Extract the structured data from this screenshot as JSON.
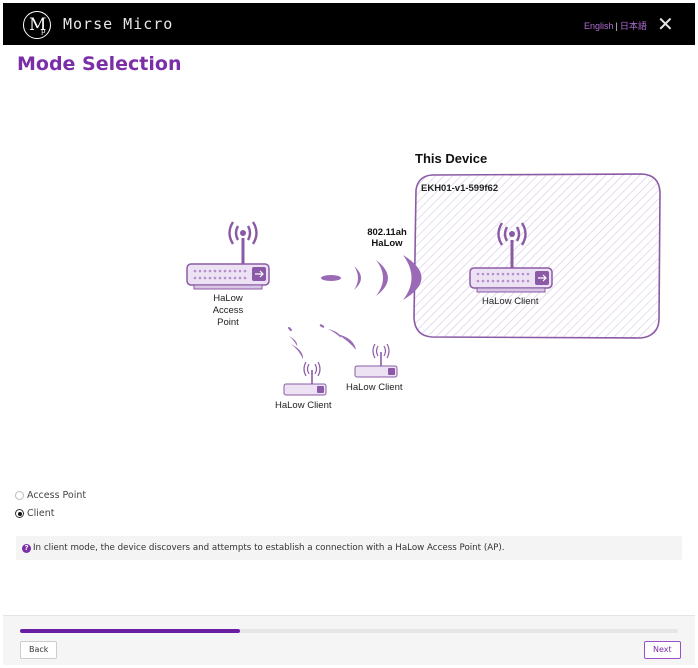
{
  "header": {
    "brand": "Morse Micro",
    "logo_letter": "M",
    "logo_sub": "p",
    "lang_english": "English",
    "lang_separator": "|",
    "lang_japanese": "日本語",
    "close_glyph": "✕"
  },
  "page": {
    "title": "Mode Selection"
  },
  "diagram": {
    "this_device_heading": "This Device",
    "device_id": "EKH01-v1-599f62",
    "link_label_line1": "802.11ah",
    "link_label_line2": "HaLow",
    "access_point_line1": "HaLow",
    "access_point_line2": "Access",
    "access_point_line3": "Point",
    "client_label": "HaLow Client",
    "client_label_2": "HaLow Client",
    "client_label_3": "HaLow Client",
    "accent_color": "#8b5aa6"
  },
  "modes": {
    "options": [
      {
        "label": "Access Point",
        "selected": false
      },
      {
        "label": "Client",
        "selected": true
      }
    ],
    "info_text": "In client mode, the device discovers and attempts to establish a connection with a HaLow Access Point (AP)."
  },
  "footer": {
    "progress": 0.335,
    "back_label": "Back",
    "next_label": "Next",
    "progress_color": "#6a1fa3"
  }
}
